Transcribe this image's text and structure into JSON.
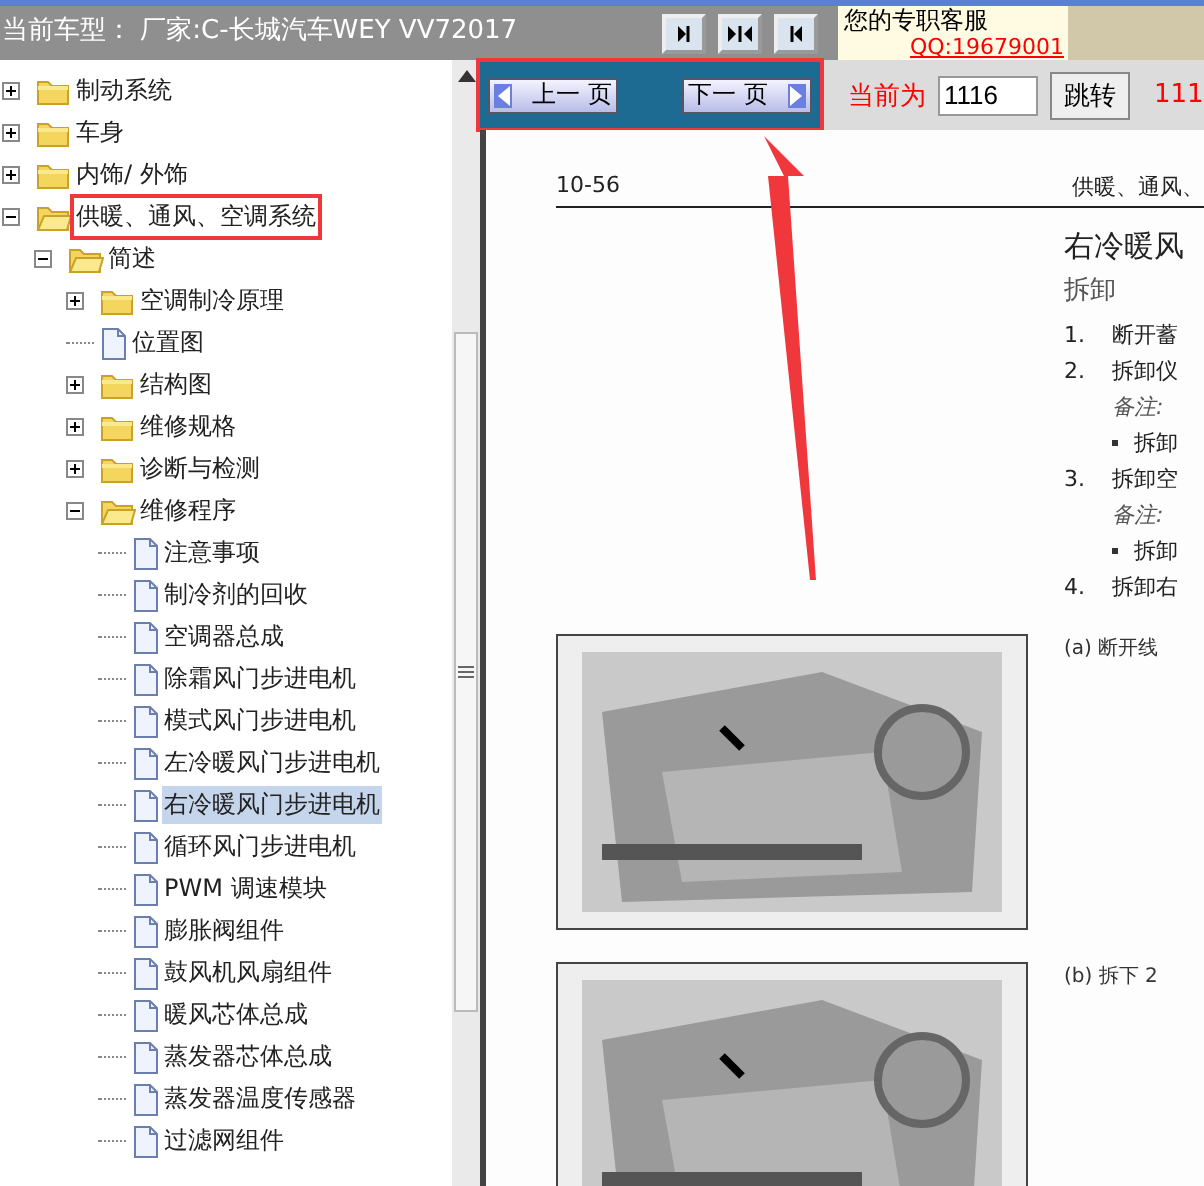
{
  "title_bar": {
    "title": "当前车型：  厂家:C-长城汽车WEY VV72017",
    "service_label": "您的专职客服",
    "qq_link": "QQ:19679001"
  },
  "tree": [
    {
      "label": "制动系统",
      "kind": "folder",
      "expanded": false,
      "selected": false,
      "highlighted": false
    },
    {
      "label": "车身",
      "kind": "folder",
      "expanded": false,
      "selected": false,
      "highlighted": false
    },
    {
      "label": "内饰/ 外饰",
      "kind": "folder",
      "expanded": false,
      "selected": false,
      "highlighted": false
    },
    {
      "label": "供暖、通风、空调系统",
      "kind": "folder",
      "expanded": true,
      "selected": false,
      "highlighted": true,
      "children": [
        {
          "label": "简述",
          "kind": "folder",
          "expanded": true,
          "selected": false,
          "highlighted": false,
          "children": [
            {
              "label": "空调制冷原理",
              "kind": "folder",
              "expanded": false,
              "selected": false,
              "highlighted": false
            },
            {
              "label": "位置图",
              "kind": "page",
              "selected": false,
              "highlighted": false
            },
            {
              "label": "结构图",
              "kind": "folder",
              "expanded": false,
              "selected": false,
              "highlighted": false
            },
            {
              "label": "维修规格",
              "kind": "folder",
              "expanded": false,
              "selected": false,
              "highlighted": false
            },
            {
              "label": "诊断与检测",
              "kind": "folder",
              "expanded": false,
              "selected": false,
              "highlighted": false
            },
            {
              "label": "维修程序",
              "kind": "folder",
              "expanded": true,
              "selected": false,
              "highlighted": false,
              "children": [
                {
                  "label": "注意事项",
                  "kind": "page",
                  "selected": false,
                  "highlighted": false
                },
                {
                  "label": "制冷剂的回收",
                  "kind": "page",
                  "selected": false,
                  "highlighted": false
                },
                {
                  "label": "空调器总成",
                  "kind": "page",
                  "selected": false,
                  "highlighted": false
                },
                {
                  "label": "除霜风门步进电机",
                  "kind": "page",
                  "selected": false,
                  "highlighted": false
                },
                {
                  "label": "模式风门步进电机",
                  "kind": "page",
                  "selected": false,
                  "highlighted": false
                },
                {
                  "label": "左冷暖风门步进电机",
                  "kind": "page",
                  "selected": false,
                  "highlighted": false
                },
                {
                  "label": "右冷暖风门步进电机",
                  "kind": "page",
                  "selected": true,
                  "highlighted": false
                },
                {
                  "label": "循环风门步进电机",
                  "kind": "page",
                  "selected": false,
                  "highlighted": false
                },
                {
                  "label": "PWM 调速模块",
                  "kind": "page",
                  "selected": false,
                  "highlighted": false
                },
                {
                  "label": "膨胀阀组件",
                  "kind": "page",
                  "selected": false,
                  "highlighted": false
                },
                {
                  "label": "鼓风机风扇组件",
                  "kind": "page",
                  "selected": false,
                  "highlighted": false
                },
                {
                  "label": "暖风芯体总成",
                  "kind": "page",
                  "selected": false,
                  "highlighted": false
                },
                {
                  "label": "蒸发器芯体总成",
                  "kind": "page",
                  "selected": false,
                  "highlighted": false
                },
                {
                  "label": "蒸发器温度传感器",
                  "kind": "page",
                  "selected": false,
                  "highlighted": false
                },
                {
                  "label": "过滤网组件",
                  "kind": "page",
                  "selected": false,
                  "highlighted": false
                }
              ]
            }
          ]
        }
      ]
    }
  ],
  "toolbar": {
    "prev_button": "上一 页",
    "next_button": "下一 页",
    "page_label": "当前为",
    "page_value": "1116",
    "go_button": "跳转",
    "total": "111"
  },
  "document": {
    "page_number": "10-56",
    "section": "供暖、通风、",
    "heading": "右冷暖风",
    "subheading": "拆卸",
    "steps": [
      {
        "kind": "step",
        "number": "1.",
        "text": "断开蓄"
      },
      {
        "kind": "step",
        "number": "2.",
        "text": "拆卸仪"
      },
      {
        "kind": "note",
        "text": "备注:"
      },
      {
        "kind": "bullet",
        "text": "拆卸"
      },
      {
        "kind": "step",
        "number": "3.",
        "text": "拆卸空"
      },
      {
        "kind": "note",
        "text": "备注:"
      },
      {
        "kind": "bullet",
        "text": "拆卸"
      },
      {
        "kind": "step",
        "number": "4.",
        "text": "拆卸右"
      }
    ],
    "figures": [
      {
        "caption": "(a) 断开线"
      },
      {
        "caption": "(b) 拆下 2"
      }
    ]
  }
}
